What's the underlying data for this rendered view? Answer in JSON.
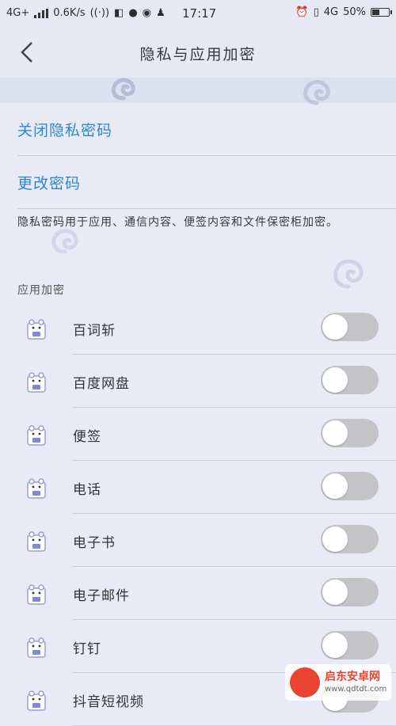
{
  "status_bar": {
    "network": "4G+",
    "speed": "0.6K/s",
    "time": "17:17",
    "network_right": "4G",
    "battery": "50%",
    "battery_level": 0.5
  },
  "header": {
    "title": "隐私与应用加密"
  },
  "actions": {
    "close_password": "关闭隐私密码",
    "change_password": "更改密码"
  },
  "description": "隐私密码用于应用、通信内容、便签内容和文件保密柜加密。",
  "section_label": "应用加密",
  "apps": [
    {
      "name": "百词斩",
      "enabled": false
    },
    {
      "name": "百度网盘",
      "enabled": false
    },
    {
      "name": "便签",
      "enabled": false
    },
    {
      "name": "电话",
      "enabled": false
    },
    {
      "name": "电子书",
      "enabled": false
    },
    {
      "name": "电子邮件",
      "enabled": false
    },
    {
      "name": "钉钉",
      "enabled": false
    },
    {
      "name": "抖音短视频",
      "enabled": false
    }
  ],
  "watermark": {
    "title": "启东安卓网",
    "url": "www.qdtdt.com"
  },
  "colors": {
    "background": "#e8eaf6",
    "link": "#2e86d4",
    "toggle_off": "#c4c4c8",
    "watermark": "#e8442f"
  }
}
